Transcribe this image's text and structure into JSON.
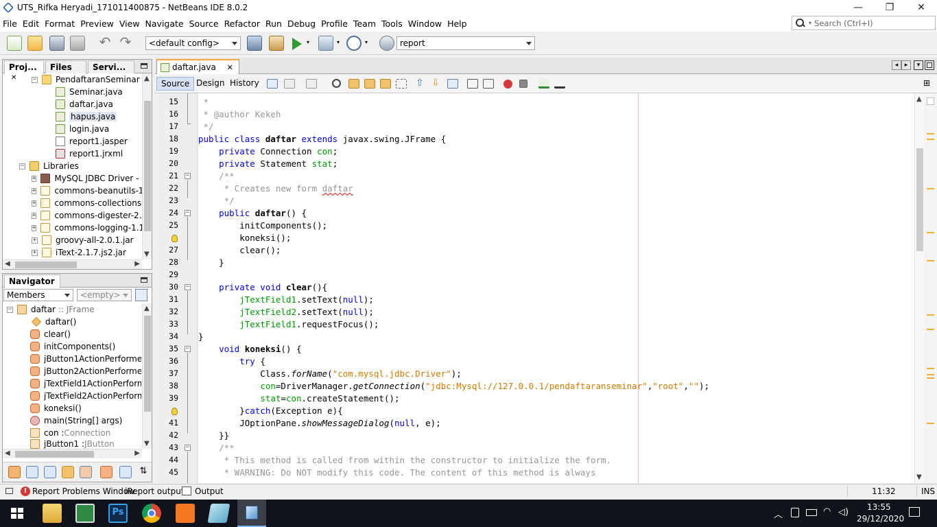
{
  "window": {
    "title": "UTS_Rifka Heryadi_171011400875 - NetBeans IDE 8.0.2",
    "controls": [
      "—",
      "❐",
      "✕"
    ]
  },
  "menu": [
    "File",
    "Edit",
    "Format",
    "Preview",
    "View",
    "Navigate",
    "Source",
    "Refactor",
    "Run",
    "Debug",
    "Profile",
    "Team",
    "Tools",
    "Window",
    "Help"
  ],
  "search": {
    "placeholder": "Search (Ctrl+I)"
  },
  "toolbar": {
    "config": "<default config>",
    "run_target": "report"
  },
  "projects_panel": {
    "tabs": [
      "Proj...",
      "Files",
      "Servi..."
    ],
    "items": [
      {
        "label": "PendaftaranSeminar",
        "icon": "package-icon"
      },
      {
        "label": "Seminar.java",
        "icon": "java-file-icon"
      },
      {
        "label": "daftar.java",
        "icon": "java-file-icon"
      },
      {
        "label": "hapus.java",
        "icon": "java-file-icon"
      },
      {
        "label": "login.java",
        "icon": "java-file-icon"
      },
      {
        "label": "report1.jasper",
        "icon": "jasper-file-icon"
      },
      {
        "label": "report1.jrxml",
        "icon": "jrxml-file-icon"
      },
      {
        "label": "Libraries",
        "icon": "libraries-icon"
      },
      {
        "label": "MySQL JDBC Driver - mys",
        "icon": "mysql-driver-icon"
      },
      {
        "label": "commons-beanutils-1.8.0",
        "icon": "jar-icon"
      },
      {
        "label": "commons-collections-2.1",
        "icon": "jar-icon"
      },
      {
        "label": "commons-digester-2.1.ja",
        "icon": "jar-icon"
      },
      {
        "label": "commons-logging-1.1.1.j",
        "icon": "jar-icon"
      },
      {
        "label": "groovy-all-2.0.1.jar",
        "icon": "jar-icon"
      },
      {
        "label": "iText-2.1.7.js2.jar",
        "icon": "jar-icon"
      }
    ]
  },
  "navigator_panel": {
    "title": "Navigator",
    "filter": "Members",
    "filter2": "<empty>",
    "root": {
      "name": "daftar",
      "type": ":: JFrame"
    },
    "items": [
      {
        "label": "daftar()",
        "extra": "",
        "icon": "constructor-icon"
      },
      {
        "label": "clear()",
        "extra": "",
        "icon": "method-icon"
      },
      {
        "label": "initComponents()",
        "extra": "",
        "icon": "method-icon"
      },
      {
        "label": "jButton1ActionPerformed(",
        "extra": "Ac",
        "icon": "method-icon"
      },
      {
        "label": "jButton2ActionPerformed(",
        "extra": "Ac",
        "icon": "method-icon"
      },
      {
        "label": "jTextField1ActionPerformed(",
        "extra": "",
        "icon": "method-icon"
      },
      {
        "label": "jTextField2ActionPerformed(",
        "extra": "",
        "icon": "method-icon"
      },
      {
        "label": "koneksi()",
        "extra": "",
        "icon": "method-icon"
      },
      {
        "label": "main(String[] args)",
        "extra": "",
        "icon": "main-method-icon"
      },
      {
        "label": "con : ",
        "extra": "Connection",
        "icon": "field-icon"
      },
      {
        "label": "jButton1 : ",
        "extra": "JButton",
        "icon": "field-icon"
      }
    ]
  },
  "editor": {
    "tab": "daftar.java",
    "views": [
      "Source",
      "Design",
      "History"
    ],
    "lines": [
      {
        "n": "15"
      },
      {
        "n": "16"
      },
      {
        "n": "17"
      },
      {
        "n": "18"
      },
      {
        "n": "19"
      },
      {
        "n": "20"
      },
      {
        "n": "21"
      },
      {
        "n": "22"
      },
      {
        "n": "23"
      },
      {
        "n": "24"
      },
      {
        "n": "25"
      },
      {
        "n": "26"
      },
      {
        "n": "27"
      },
      {
        "n": "28"
      },
      {
        "n": "29"
      },
      {
        "n": "30"
      },
      {
        "n": "31"
      },
      {
        "n": "32"
      },
      {
        "n": "33"
      },
      {
        "n": "34"
      },
      {
        "n": "35"
      },
      {
        "n": "36"
      },
      {
        "n": "37"
      },
      {
        "n": "38"
      },
      {
        "n": "39"
      },
      {
        "n": "40"
      },
      {
        "n": "41"
      },
      {
        "n": "42"
      },
      {
        "n": "43"
      },
      {
        "n": "44"
      },
      {
        "n": "45"
      }
    ],
    "code": {
      "l15": " *",
      "l16": " * @author Kekeh",
      "l17": " */",
      "l18a": "public class ",
      "l18b": "daftar",
      "l18c": " extends ",
      "l18d": "javax.swing.JFrame {",
      "l19a": "    private ",
      "l19b": "Connection ",
      "l19c": "con",
      "l19d": ";",
      "l20a": "    private ",
      "l20b": "Statement ",
      "l20c": "stat",
      "l20d": ";",
      "l21": "    /**",
      "l22a": "     * Creates new form ",
      "l22b": "daftar",
      "l23": "     */",
      "l24a": "    public ",
      "l24b": "daftar",
      "l24c": "() {",
      "l25": "        initComponents();",
      "l26": "        koneksi();",
      "l27": "        clear();",
      "l28": "    }",
      "l29": "",
      "l30a": "    private void ",
      "l30b": "clear",
      "l30c": "(){",
      "l31a": "        ",
      "l31b": "jTextField1",
      "l31c": ".setText(",
      "l31d": "null",
      "l31e": ");",
      "l32a": "        ",
      "l32b": "jTextField2",
      "l32c": ".setText(",
      "l32d": "null",
      "l32e": ");",
      "l33a": "        ",
      "l33b": "jTextField1",
      "l33c": ".requestFocus();",
      "l34": "}",
      "l35a": "    void ",
      "l35b": "koneksi",
      "l35c": "() {",
      "l36a": "        try",
      "l36b": " {",
      "l37a": "            Class.",
      "l37b": "forName",
      "l37c": "(",
      "l37d": "\"com.mysql.jdbc.Driver\"",
      "l37e": ");",
      "l38a": "            ",
      "l38b": "con",
      "l38c": "=DriverManager.",
      "l38d": "getConnection",
      "l38e": "(",
      "l38f": "\"jdbc:Mysql://127.0.0.1/pendaftaranseminar\"",
      "l38g": ",",
      "l38h": "\"root\"",
      "l38i": ",",
      "l38j": "\"\"",
      "l38k": ");",
      "l39a": "            ",
      "l39b": "stat",
      "l39c": "=",
      "l39d": "con",
      "l39e": ".createStatement();",
      "l40a": "        }",
      "l40b": "catch",
      "l40c": "(Exception e){",
      "l41a": "        JOptionPane.",
      "l41b": "showMessageDialog",
      "l41c": "(",
      "l41d": "null",
      "l41e": ", e);",
      "l42": "    }}",
      "l43": "    /**",
      "l44": "     * This method is called from within the constructor to initialize the form.",
      "l45": "     * WARNING: Do NOT modify this code. The content of this method is always"
    }
  },
  "status": {
    "problems": "Report Problems Window",
    "ireport": "iReport output",
    "output": "Output",
    "position": "11:32",
    "mode": "INS"
  },
  "taskbar": {
    "time": "13:55",
    "date": "29/12/2020"
  }
}
